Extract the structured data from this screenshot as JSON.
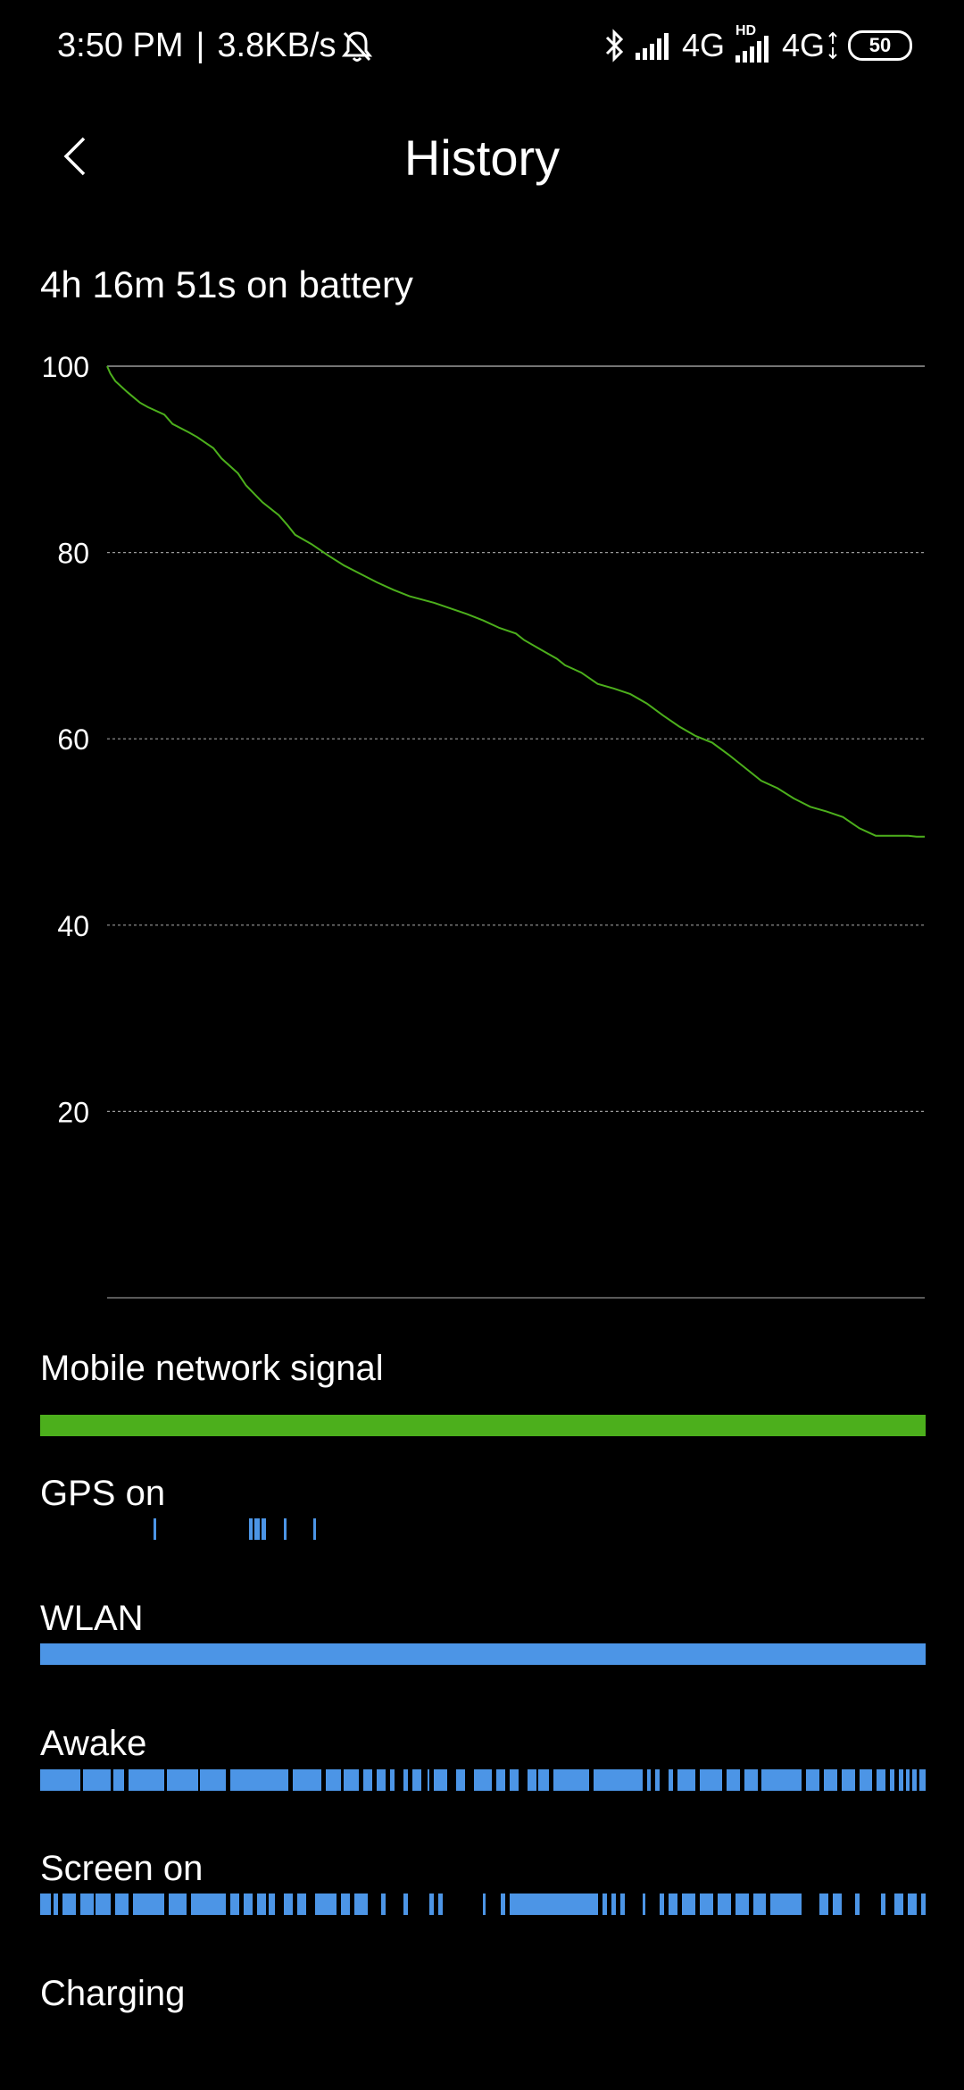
{
  "status_bar": {
    "time": "3:50 PM",
    "separator": "|",
    "net_speed": "3.8KB/s",
    "network_1": "4G",
    "hd_badge": "HD",
    "network_2": "4G",
    "battery": "50",
    "icons": [
      "mute-bell-icon",
      "bluetooth-icon",
      "signal-icon",
      "signal-icon",
      "data-arrows-icon"
    ]
  },
  "header": {
    "title": "History",
    "back_icon": "chevron-left-icon"
  },
  "summary": "4h 16m 51s on battery",
  "chart_data": {
    "type": "line",
    "title": "",
    "xlabel": "",
    "ylabel": "",
    "ylim": [
      0,
      100
    ],
    "yticks": [
      "100",
      "80",
      "60",
      "40",
      "20"
    ],
    "grid": true,
    "series": [
      {
        "color": "#4caf1c",
        "x": [
          0,
          0.004,
          0.01,
          0.025,
          0.04,
          0.05,
          0.07,
          0.08,
          0.1,
          0.11,
          0.13,
          0.14,
          0.16,
          0.17,
          0.19,
          0.21,
          0.22,
          0.23,
          0.24,
          0.25,
          0.27,
          0.29,
          0.31,
          0.33,
          0.35,
          0.37,
          0.4,
          0.42,
          0.44,
          0.46,
          0.48,
          0.5,
          0.51,
          0.53,
          0.55,
          0.56,
          0.58,
          0.6,
          0.62,
          0.64,
          0.66,
          0.68,
          0.7,
          0.72,
          0.74,
          0.76,
          0.78,
          0.8,
          0.82,
          0.84,
          0.86,
          0.88,
          0.9,
          0.92,
          0.94,
          0.96,
          0.98,
          0.99,
          1.0
        ],
        "y": [
          100,
          99.2,
          98.4,
          97.2,
          96.1,
          95.6,
          94.8,
          93.8,
          92.9,
          92.4,
          91.2,
          90.1,
          88.5,
          87.2,
          85.4,
          84,
          83,
          81.9,
          81.4,
          80.9,
          79.7,
          78.6,
          77.7,
          76.8,
          76,
          75.3,
          74.6,
          74,
          73.4,
          72.7,
          71.9,
          71.3,
          70.6,
          69.6,
          68.6,
          67.9,
          67.1,
          65.9,
          65.4,
          64.8,
          63.8,
          62.5,
          61.3,
          60.3,
          59.6,
          58.3,
          56.9,
          55.5,
          54.7,
          53.6,
          52.7,
          52.2,
          51.6,
          50.4,
          49.6,
          49.6,
          49.6,
          49.5,
          49.5
        ]
      }
    ]
  },
  "sections": {
    "mobile_signal": {
      "label": "Mobile network signal",
      "color": "#4caf1c",
      "segments": [
        [
          0,
          1
        ]
      ]
    },
    "gps": {
      "label": "GPS on",
      "color": "#4c95e6",
      "segments": [
        [
          0.128,
          0.131
        ],
        [
          0.236,
          0.24
        ],
        [
          0.242,
          0.248
        ],
        [
          0.25,
          0.255
        ],
        [
          0.275,
          0.278
        ],
        [
          0.308,
          0.311
        ]
      ]
    },
    "wlan": {
      "label": "WLAN",
      "color": "#4c95e6",
      "segments": [
        [
          0,
          1
        ]
      ]
    },
    "awake": {
      "label": "Awake",
      "color": "#4c95e6",
      "segments": [
        [
          0,
          0.045
        ],
        [
          0.048,
          0.08
        ],
        [
          0.083,
          0.095
        ],
        [
          0.1,
          0.14
        ],
        [
          0.143,
          0.178
        ],
        [
          0.18,
          0.21
        ],
        [
          0.215,
          0.28
        ],
        [
          0.285,
          0.318
        ],
        [
          0.323,
          0.34
        ],
        [
          0.343,
          0.36
        ],
        [
          0.365,
          0.375
        ],
        [
          0.38,
          0.39
        ],
        [
          0.395,
          0.4
        ],
        [
          0.41,
          0.415
        ],
        [
          0.42,
          0.43
        ],
        [
          0.437,
          0.44
        ],
        [
          0.445,
          0.46
        ],
        [
          0.47,
          0.48
        ],
        [
          0.49,
          0.51
        ],
        [
          0.515,
          0.525
        ],
        [
          0.53,
          0.54
        ],
        [
          0.55,
          0.56
        ],
        [
          0.563,
          0.575
        ],
        [
          0.58,
          0.62
        ],
        [
          0.625,
          0.68
        ],
        [
          0.685,
          0.69
        ],
        [
          0.695,
          0.7
        ],
        [
          0.71,
          0.715
        ],
        [
          0.72,
          0.74
        ],
        [
          0.745,
          0.77
        ],
        [
          0.775,
          0.79
        ],
        [
          0.795,
          0.81
        ],
        [
          0.815,
          0.86
        ],
        [
          0.865,
          0.88
        ],
        [
          0.885,
          0.9
        ],
        [
          0.905,
          0.92
        ],
        [
          0.925,
          0.94
        ],
        [
          0.945,
          0.955
        ],
        [
          0.96,
          0.965
        ],
        [
          0.97,
          0.975
        ],
        [
          0.978,
          0.982
        ],
        [
          0.985,
          0.99
        ],
        [
          0.993,
          1.0
        ]
      ]
    },
    "screen_on": {
      "label": "Screen on",
      "color": "#4c95e6",
      "segments": [
        [
          0,
          0.012
        ],
        [
          0.015,
          0.02
        ],
        [
          0.025,
          0.04
        ],
        [
          0.045,
          0.06
        ],
        [
          0.063,
          0.08
        ],
        [
          0.085,
          0.1
        ],
        [
          0.105,
          0.14
        ],
        [
          0.145,
          0.165
        ],
        [
          0.17,
          0.21
        ],
        [
          0.215,
          0.225
        ],
        [
          0.23,
          0.24
        ],
        [
          0.245,
          0.255
        ],
        [
          0.258,
          0.265
        ],
        [
          0.275,
          0.285
        ],
        [
          0.29,
          0.3
        ],
        [
          0.31,
          0.335
        ],
        [
          0.34,
          0.35
        ],
        [
          0.355,
          0.37
        ],
        [
          0.385,
          0.39
        ],
        [
          0.41,
          0.415
        ],
        [
          0.44,
          0.445
        ],
        [
          0.45,
          0.455
        ],
        [
          0.5,
          0.503
        ],
        [
          0.52,
          0.525
        ],
        [
          0.53,
          0.63
        ],
        [
          0.635,
          0.64
        ],
        [
          0.645,
          0.65
        ],
        [
          0.655,
          0.66
        ],
        [
          0.68,
          0.683
        ],
        [
          0.7,
          0.705
        ],
        [
          0.71,
          0.72
        ],
        [
          0.725,
          0.74
        ],
        [
          0.745,
          0.76
        ],
        [
          0.765,
          0.78
        ],
        [
          0.785,
          0.8
        ],
        [
          0.805,
          0.82
        ],
        [
          0.825,
          0.86
        ],
        [
          0.88,
          0.89
        ],
        [
          0.895,
          0.905
        ],
        [
          0.92,
          0.925
        ],
        [
          0.95,
          0.955
        ],
        [
          0.965,
          0.975
        ],
        [
          0.98,
          0.99
        ],
        [
          0.995,
          1.0
        ]
      ]
    },
    "charging": {
      "label": "Charging",
      "color": "#4c95e6",
      "segments": []
    }
  }
}
